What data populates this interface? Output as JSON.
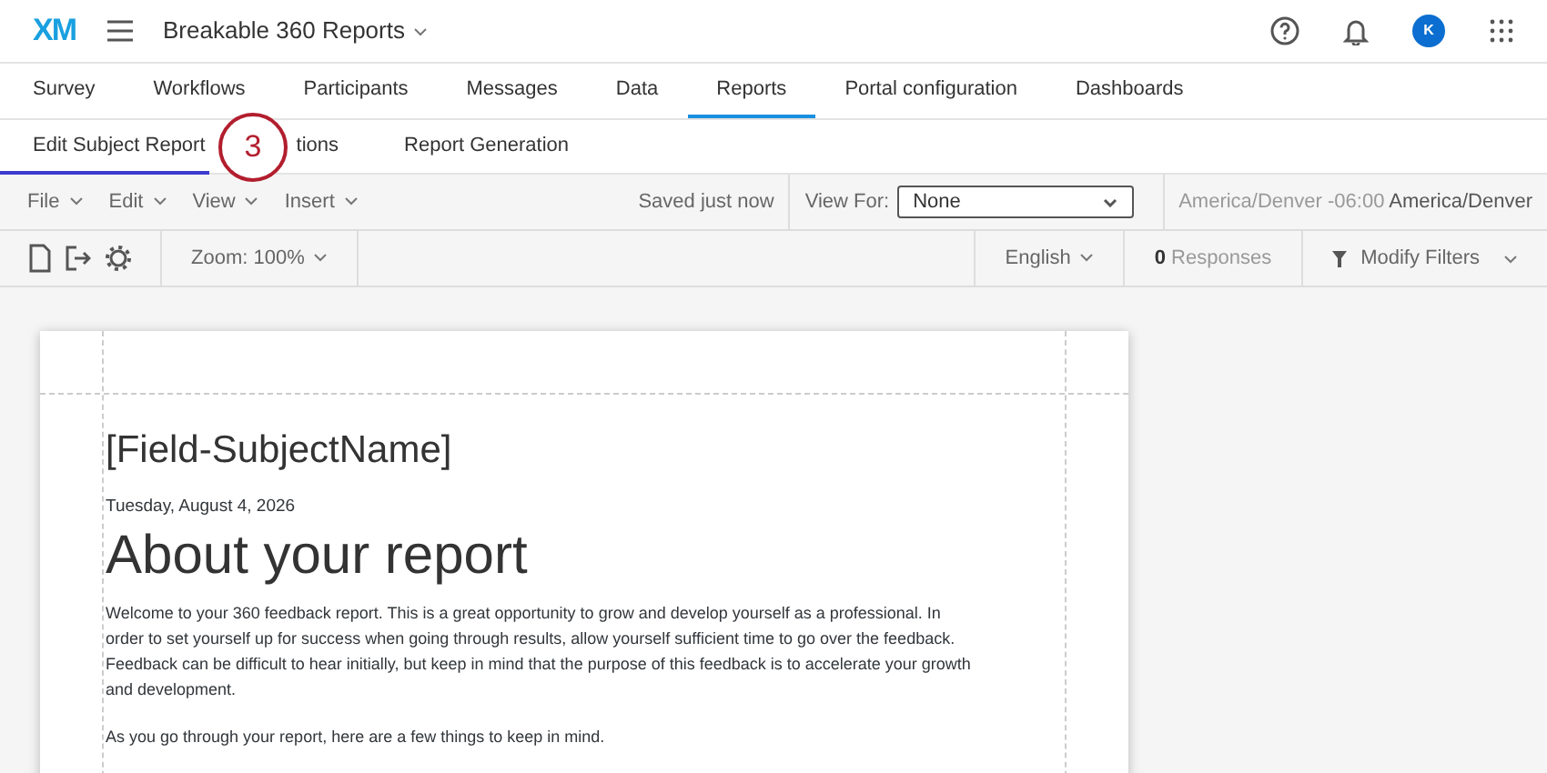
{
  "header": {
    "logo": "XM",
    "project": "Breakable 360 Reports",
    "avatar": "K"
  },
  "tabs": [
    {
      "label": "Survey",
      "selected": false
    },
    {
      "label": "Workflows",
      "selected": false
    },
    {
      "label": "Participants",
      "selected": false
    },
    {
      "label": "Messages",
      "selected": false
    },
    {
      "label": "Data",
      "selected": false
    },
    {
      "label": "Reports",
      "selected": true
    },
    {
      "label": "Portal configuration",
      "selected": false
    },
    {
      "label": "Dashboards",
      "selected": false
    }
  ],
  "subtabs": [
    {
      "label": "Edit Subject Report",
      "selected": true
    },
    {
      "label": "tions",
      "selected": false
    },
    {
      "label": "Report Generation",
      "selected": false
    }
  ],
  "callout": "3",
  "menus": [
    "File",
    "Edit",
    "View",
    "Insert"
  ],
  "save_status": "Saved just now",
  "view_for": {
    "label": "View For:",
    "value": "None"
  },
  "timezone": {
    "offset": "America/Denver -06:00",
    "name": "America/Denver"
  },
  "zoom": "Zoom: 100%",
  "language": "English",
  "responses": {
    "count": "0",
    "label": "Responses"
  },
  "filters": "Modify Filters",
  "document": {
    "field": "[Field-SubjectName]",
    "date": "Tuesday, August 4, 2026",
    "heading": "About your report",
    "paragraphs": [
      "Welcome to your 360 feedback report. This is a great opportunity to grow and develop yourself as a professional. In order to set yourself up for success when going through results, allow yourself sufficient time to go over the feedback. Feedback can be difficult to hear initially, but keep in mind that the purpose of this feedback is to accelerate your growth and development.",
      "As you go through your report, here are a few things to keep in mind."
    ]
  }
}
